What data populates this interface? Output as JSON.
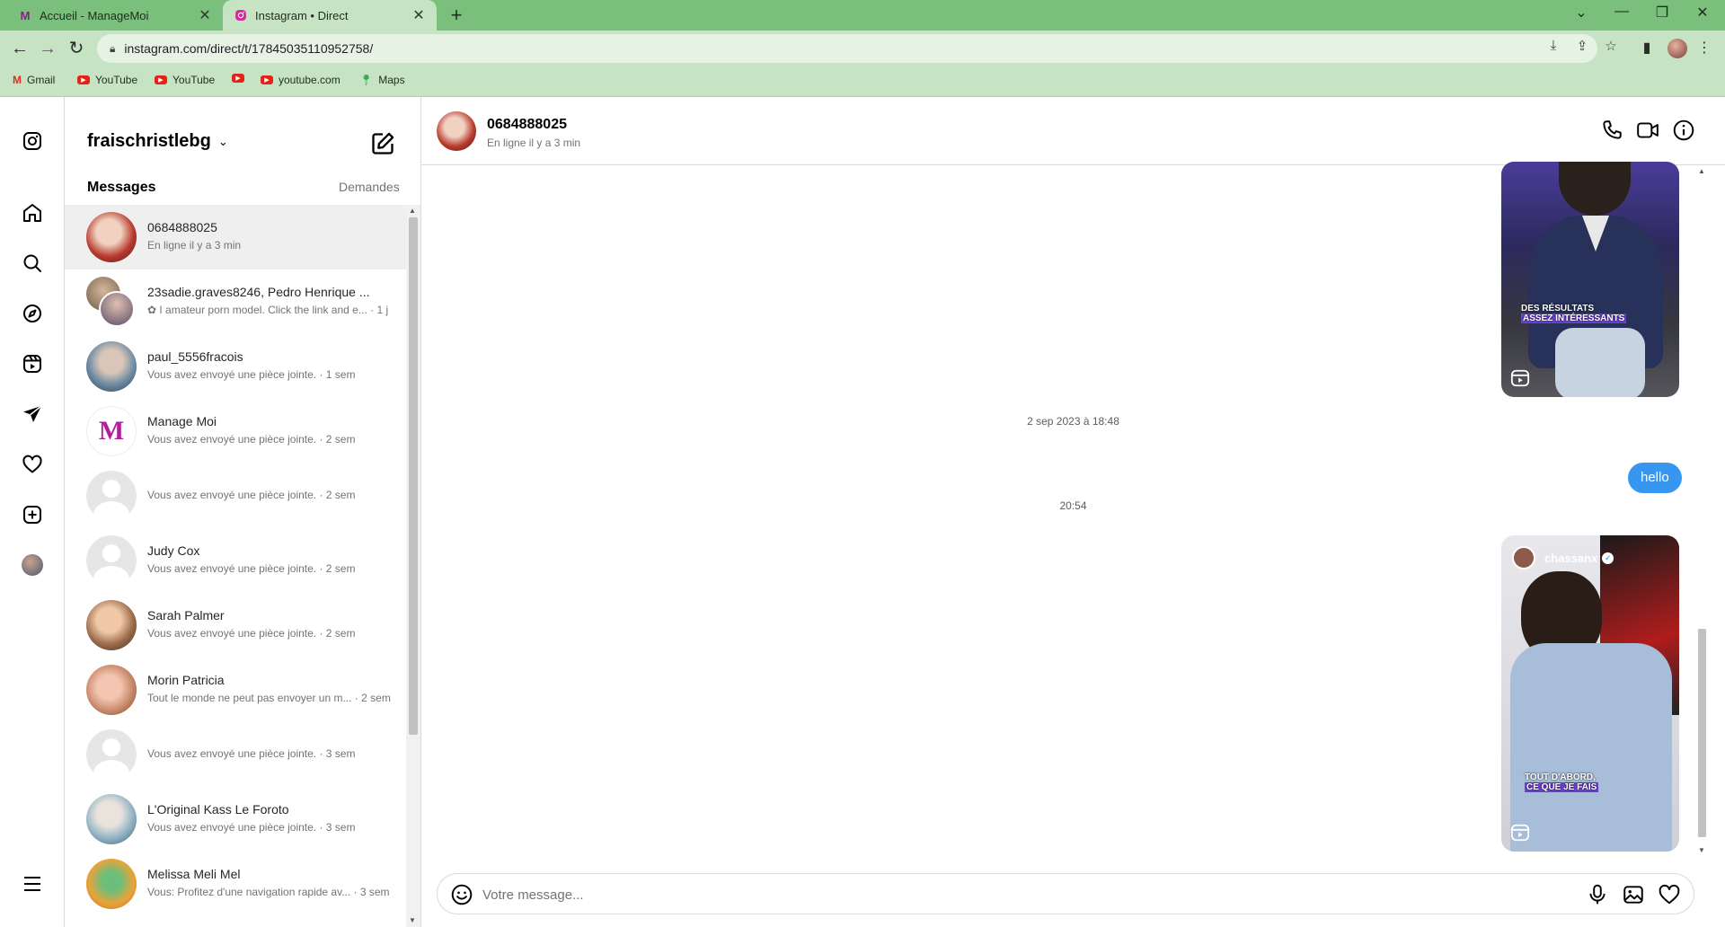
{
  "browser": {
    "tabs": [
      {
        "title": "Accueil - ManageMoi",
        "favicon": "M"
      },
      {
        "title": "Instagram • Direct",
        "favicon": "instagram"
      }
    ],
    "url": "instagram.com/direct/t/17845035110952758/",
    "bookmarks": [
      {
        "label": "Gmail",
        "icon": "gmail-icon"
      },
      {
        "label": "YouTube",
        "icon": "youtube-icon"
      },
      {
        "label": "YouTube",
        "icon": "youtube-icon"
      },
      {
        "label": "",
        "icon": "youtube-icon"
      },
      {
        "label": "youtube.com",
        "icon": "youtube-icon"
      },
      {
        "label": "Maps",
        "icon": "maps-icon"
      }
    ]
  },
  "inbox": {
    "username": "fraischristlebg",
    "messages_label": "Messages",
    "requests_label": "Demandes",
    "threads": [
      {
        "name": "0684888025",
        "preview": "En ligne il y a 3 min",
        "active": true
      },
      {
        "name": "23sadie.graves8246, Pedro Henrique ...",
        "preview": "✿ I amateur porn model. Click the link and e... · 1 j"
      },
      {
        "name": "paul_5556fracois",
        "preview": "Vous avez envoyé une pièce jointe. · 1 sem"
      },
      {
        "name": "Manage Moi",
        "preview": "Vous avez envoyé une pièce jointe. · 2 sem"
      },
      {
        "name": "",
        "preview": "Vous avez envoyé une pièce jointe. · 2 sem"
      },
      {
        "name": "Judy Cox",
        "preview": "Vous avez envoyé une pièce jointe. · 2 sem"
      },
      {
        "name": "Sarah Palmer",
        "preview": "Vous avez envoyé une pièce jointe. · 2 sem"
      },
      {
        "name": "Morin Patricia",
        "preview": "Tout le monde ne peut pas envoyer un m... · 2 sem"
      },
      {
        "name": "",
        "preview": "Vous avez envoyé une pièce jointe. · 3 sem"
      },
      {
        "name": "L'Original Kass Le Foroto",
        "preview": "Vous avez envoyé une pièce jointe. · 3 sem"
      },
      {
        "name": "Melissa Meli Mel",
        "preview": "Vous: Profitez d'une navigation rapide av... · 3 sem"
      }
    ]
  },
  "chat": {
    "contact_name": "0684888025",
    "contact_status": "En ligne il y a 3 min",
    "timestamp_1": "2 sep 2023 à 18:48",
    "timestamp_2": "20:54",
    "outgoing_message": "hello",
    "reel1_caption_line1": "DES RÉSULTATS",
    "reel1_caption_line2": "ASSEZ INTÉRESSANTS",
    "reel2_author": "chassanx",
    "reel2_caption_line1": "TOUT D'ABORD,",
    "reel2_caption_line2": "CE QUE JE FAIS",
    "composer_placeholder": "Votre message..."
  },
  "colors": {
    "tabbar": "#7bbf7d",
    "toolbar": "#c6e3c3",
    "bubble_outgoing": "#3797f0"
  }
}
